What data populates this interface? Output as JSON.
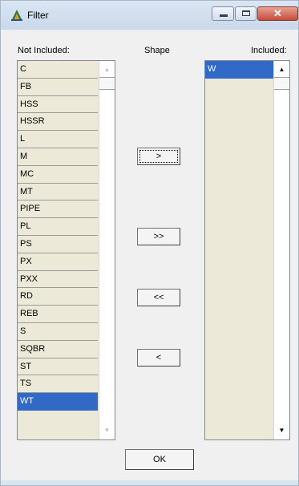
{
  "window": {
    "title": "Filter",
    "close_glyph": "✕"
  },
  "headers": {
    "not_included": "Not Included:",
    "shape": "Shape",
    "included": "Included:"
  },
  "not_included_items": [
    "C",
    "FB",
    "HSS",
    "HSSR",
    "L",
    "M",
    "MC",
    "MT",
    "PIPE",
    "PL",
    "PS",
    "PX",
    "PXX",
    "RD",
    "REB",
    "S",
    "SQBR",
    "ST",
    "TS",
    "WT"
  ],
  "not_included_selected": "WT",
  "included_items": [
    "W"
  ],
  "included_selected": "W",
  "buttons": {
    "add": ">",
    "add_all": ">>",
    "remove_all": "<<",
    "remove": "<",
    "ok": "OK"
  },
  "scroll_arrows": {
    "up": "▲",
    "down": "▼"
  },
  "colors": {
    "selection": "#3169c6",
    "list_background": "#ece9d8"
  }
}
